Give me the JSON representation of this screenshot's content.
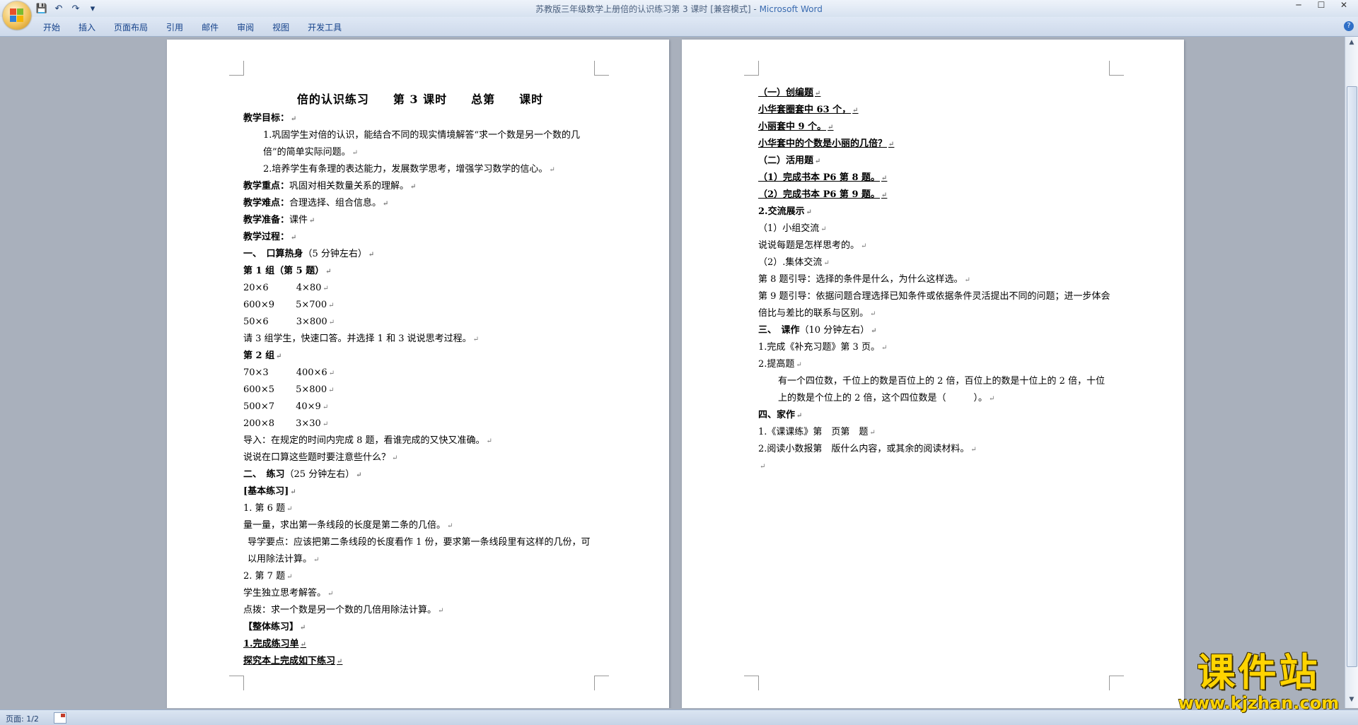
{
  "window": {
    "title": "苏教版三年级数学上册倍的认识练习第 3 课时 [兼容模式] - ",
    "app_name": "Microsoft Word",
    "controls": [
      "─",
      "☐",
      "✕"
    ]
  },
  "qat": {
    "save": "💾",
    "undo": "↶",
    "redo": "↷",
    "dropdown": "▾"
  },
  "ribbon": {
    "tabs": [
      "开始",
      "插入",
      "页面布局",
      "引用",
      "邮件",
      "审阅",
      "视图",
      "开发工具"
    ],
    "help": "?"
  },
  "page1": {
    "title": "倍的认识练习　　第 3 课时　　总第　　课时",
    "lines": [
      {
        "t": "教学目标：",
        "s": "b"
      },
      {
        "t": "1.巩固学生对倍的认识，能结合不同的现实情境解答“求一个数是另一个数的几倍”的简单实际问题。",
        "s": "tall ind1"
      },
      {
        "t": "2.培养学生有条理的表达能力，发展数学思考，增强学习数学的信心。",
        "s": "ind1"
      },
      {
        "t": "教学重点：",
        "r": "巩固对相关数量关系的理解。",
        "s": "b"
      },
      {
        "t": "教学难点：",
        "r": "合理选择、组合信息。",
        "s": "b"
      },
      {
        "t": "教学准备：",
        "r": "课件",
        "s": "b"
      },
      {
        "t": "教学过程：",
        "s": "b"
      },
      {
        "t": " 一、　口算热身",
        "r": "（5 分钟左右）",
        "s": "b"
      },
      {
        "t": "第 1 组（第 5 题）",
        "s": "b"
      },
      {
        "t": "20×6　　　4×80",
        "s": ""
      },
      {
        "t": "600×9　　 5×700",
        "s": ""
      },
      {
        "t": "50×6　　　3×800",
        "s": ""
      },
      {
        "t": "请 3 组学生，快速口答。并选择 1 和 3 说说思考过程。",
        "s": ""
      },
      {
        "t": "第 2 组",
        "s": "b"
      },
      {
        "t": "70×3　　　400×6",
        "s": ""
      },
      {
        "t": "600×5　　 5×800",
        "s": ""
      },
      {
        "t": "500×7　　 40×9",
        "s": ""
      },
      {
        "t": "200×8　　 3×30",
        "s": ""
      },
      {
        "t": "导入：在规定的时间内完成 8 题，看谁完成的又快又准确。",
        "s": ""
      },
      {
        "t": "说说在口算这些题时要注意些什么？",
        "s": ""
      },
      {
        "t": " 二、　练习",
        "r": "（25 分钟左右）",
        "s": "b"
      },
      {
        "t": "[基本练习]",
        "s": "b"
      },
      {
        "t": " 1. 第 6 题",
        "s": ""
      },
      {
        "t": " 量一量，求出第一条线段的长度是第二条的几倍。",
        "s": ""
      },
      {
        "t": " 导学要点：应该把第二条线段的长度看作 1 份，要求第一条线段里有这样的几份，可以用除法计算。",
        "s": "tall ind2"
      },
      {
        "t": " 2. 第 7 题",
        "s": ""
      },
      {
        "t": " 学生独立思考解答。",
        "s": ""
      },
      {
        "t": " 点拨：求一个数是另一个数的几倍用除法计算。",
        "s": ""
      },
      {
        "t": "【整体练习】",
        "s": "b"
      },
      {
        "t": "1.完成练习单",
        "s": "u"
      },
      {
        "t": "探究本上完成如下练习",
        "s": "u"
      }
    ]
  },
  "page2": {
    "lines": [
      {
        "t": "（一）创编题",
        "s": "u"
      },
      {
        "t": "小华套圈套中 63 个，",
        "s": "u"
      },
      {
        "t": "小丽套中 9 个。",
        "s": "u"
      },
      {
        "t": "小华套中的个数是小丽的几倍？",
        "s": "u"
      },
      {
        "t": "（二）活用题",
        "s": "b"
      },
      {
        "t": "（1）完成书本 P6 第 8 题。",
        "s": "u"
      },
      {
        "t": "（2）完成书本 P6 第 9 题。",
        "s": "u"
      },
      {
        "t": "2.交流展示",
        "s": "b"
      },
      {
        "t": "（1）小组交流",
        "s": ""
      },
      {
        "t": "说说每题是怎样思考的。",
        "s": ""
      },
      {
        "t": "（2）.集体交流",
        "s": ""
      },
      {
        "t": "第 8 题引导：选择的条件是什么，为什么这样选。",
        "s": ""
      },
      {
        "t": "第 9 题引导：依据问题合理选择已知条件或依据条件灵活提出不同的问题；进一步体会倍比与差比的联系与区别。",
        "s": "tall"
      },
      {
        "t": " 三、　课作",
        "r": "（10 分钟左右）",
        "s": "b"
      },
      {
        "t": "1.完成《补充习题》第 3 页。",
        "s": ""
      },
      {
        "t": "2.提高题",
        "s": ""
      },
      {
        "t": "有一个四位数，千位上的数是百位上的 2 倍，百位上的数是十位上的 2 倍，十位上的数是个位上的 2 倍，这个四位数是（　　　）。",
        "s": "tall ind1"
      },
      {
        "t": "四、家作",
        "s": "b"
      },
      {
        "t": "1.《课课练》第　页第　题",
        "s": ""
      },
      {
        "t": "2.阅读小数报第　版什么内容，或其余的阅读材料。",
        "s": ""
      },
      {
        "t": "",
        "s": ""
      }
    ]
  },
  "status": {
    "page": "页面: 1/2"
  },
  "watermark": {
    "text": "课件站",
    "url": "www.kjzhan.com"
  },
  "colors": {
    "accent": "#15428b",
    "watermark": "#ffd400"
  }
}
